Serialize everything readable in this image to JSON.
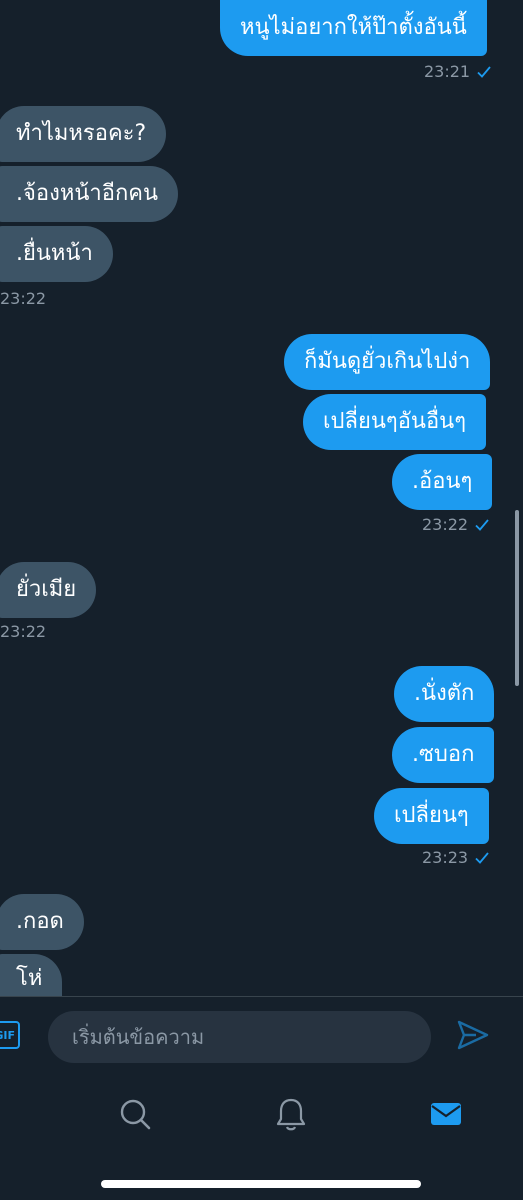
{
  "messages": [
    {
      "text": "หนูไม่อยากให้ป๊าตั้งอันนี้"
    },
    {
      "text": "ทำไมหรอคะ?"
    },
    {
      "text": ".จ้องหน้าอีกคน"
    },
    {
      "text": ".ยื่นหน้า"
    },
    {
      "text": "ก็มันดูยั่วเกินไปง่า"
    },
    {
      "text": "เปลี่ยนๆอันอื่นๆ"
    },
    {
      "text": ".อ้อนๆ"
    },
    {
      "text": "ยั่วเมีย"
    },
    {
      "text": ".นั่งตัก"
    },
    {
      "text": ".ซบอก"
    },
    {
      "text": "เปลี่ยนๆ"
    },
    {
      "text": ".กอด"
    },
    {
      "text": "โห่"
    }
  ],
  "timestamps": [
    "23:21",
    "23:22",
    "23:22",
    "23:22",
    "23:23"
  ],
  "composer": {
    "gif_label": "GIF",
    "placeholder": "เริ่มต้นข้อความ"
  },
  "colors": {
    "background": "#15202b",
    "sent_bubble": "#1d9bf0",
    "received_bubble": "#3d5466",
    "accent": "#1d9bf0"
  },
  "icons": [
    "send-icon",
    "search-icon",
    "bell-icon",
    "mail-icon",
    "read-check-icon"
  ]
}
